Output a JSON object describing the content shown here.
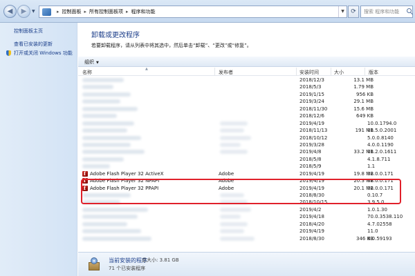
{
  "address_bar": {
    "crumbs": [
      "控制面板",
      "所有控制面板项",
      "程序和功能"
    ],
    "search_placeholder": "搜索 程序和功能"
  },
  "left_pane": {
    "home_link": "控制面板主页",
    "view_updates": "查看已安装的更新",
    "windows_features": "打开或关闭 Windows 功能"
  },
  "main": {
    "title": "卸载或更改程序",
    "description": "若要卸载程序，请从列表中将其选中，然后单击“卸载”、“更改”或“修复”。",
    "organize": "组织"
  },
  "columns": {
    "name": "名称",
    "publisher": "发布者",
    "installed_on": "安装时间",
    "size": "大小",
    "version": "版本"
  },
  "programs": [
    {
      "name": "",
      "publisher": "",
      "date": "2018/12/3",
      "size": "13.1 MB",
      "version": ""
    },
    {
      "name": "",
      "publisher": "",
      "date": "2018/5/3",
      "size": "1.79 MB",
      "version": ""
    },
    {
      "name": "",
      "publisher": "",
      "date": "2019/1/15",
      "size": "956 KB",
      "version": ""
    },
    {
      "name": "",
      "publisher": "",
      "date": "2019/3/24",
      "size": "29.1 MB",
      "version": ""
    },
    {
      "name": "",
      "publisher": "",
      "date": "2018/11/30",
      "size": "15.6 MB",
      "version": ""
    },
    {
      "name": "",
      "publisher": "",
      "date": "2018/12/6",
      "size": "649 KB",
      "version": ""
    },
    {
      "name": "",
      "publisher": "",
      "date": "2019/4/19",
      "size": "",
      "version": "10.0.1794.0"
    },
    {
      "name": "",
      "publisher": "",
      "date": "2018/11/13",
      "size": "191 MB",
      "version": "11.5.0.2001"
    },
    {
      "name": "",
      "publisher": "",
      "date": "2018/10/12",
      "size": "",
      "version": "5.0.0.8140"
    },
    {
      "name": "",
      "publisher": "",
      "date": "2019/3/28",
      "size": "",
      "version": "4.0.0.1190"
    },
    {
      "name": "",
      "publisher": "",
      "date": "2019/4/8",
      "size": "33.2 MB",
      "version": "11.2.0.1611"
    },
    {
      "name": "",
      "publisher": "",
      "date": "2018/5/8",
      "size": "",
      "version": "4.1.8.711"
    },
    {
      "name": "",
      "publisher": "",
      "date": "2018/5/9",
      "size": "",
      "version": "1.1"
    },
    {
      "name": "Adobe Flash Player 32 ActiveX",
      "publisher": "Adobe",
      "date": "2019/4/19",
      "size": "19.8 MB",
      "version": "32.0.0.171"
    },
    {
      "name": "Adobe Flash Player 32 NPAPI",
      "publisher": "Adobe",
      "date": "2019/4/19",
      "size": "20.3 MB",
      "version": "32.0.0.171"
    },
    {
      "name": "Adobe Flash Player 32 PPAPI",
      "publisher": "Adobe",
      "date": "2019/4/19",
      "size": "20.1 MB",
      "version": "32.0.0.171"
    },
    {
      "name": "",
      "publisher": "",
      "date": "2018/8/30",
      "size": "",
      "version": "0.10.7"
    },
    {
      "name": "",
      "publisher": "",
      "date": "2018/10/15",
      "size": "",
      "version": "3.9.5.0"
    },
    {
      "name": "",
      "publisher": "",
      "date": "2019/4/2",
      "size": "",
      "version": "1.0.1.30"
    },
    {
      "name": "",
      "publisher": "",
      "date": "2019/4/18",
      "size": "",
      "version": "70.0.3538.110"
    },
    {
      "name": "",
      "publisher": "",
      "date": "2018/4/20",
      "size": "",
      "version": "4.7.02558"
    },
    {
      "name": "",
      "publisher": "",
      "date": "2019/4/19",
      "size": "",
      "version": "11.0"
    },
    {
      "name": "",
      "publisher": "",
      "date": "2018/8/30",
      "size": "346 KB",
      "version": "8.0.59193"
    }
  ],
  "status": {
    "title": "当前安装的程序",
    "total": "总大小: 3.81 GB",
    "count": "71 个已安装程序"
  }
}
